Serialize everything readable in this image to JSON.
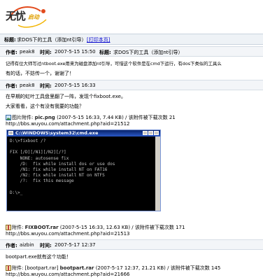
{
  "logo": {
    "wu": "无忧",
    "sub": "启动"
  },
  "topic": {
    "label": "标题:",
    "title": "求DOS下的工具（添加nt引导）",
    "print_link": "[打印本页]"
  },
  "posts": [
    {
      "author_label": "作者:",
      "author": "peak8",
      "time_label": "时间:",
      "time": "2007-5-15 15:50",
      "subject_label": "标题:",
      "subject": "求DOS下的工具（添加nt引导）",
      "body": [
        "记得有位大师写过ntboot.exe用来为磁盘添加nt引导，可惜这个软件是在cmd下运行，有dos下类似的工具么",
        "有的话，不妨传一个，谢谢了！"
      ]
    },
    {
      "author_label": "作者:",
      "author": "peak8",
      "time_label": "时间:",
      "time": "2007-5-15 16:33",
      "body": [
        "在早期的虹叶工具盘里翻了一阵，发现个fixboot.exe。",
        "大家看看，这个有没有我要的功能？"
      ],
      "image_attachment": {
        "prefix": "图片附件:",
        "name": "pic.png",
        "meta": "(2007-5-15 16:33, 7.44 KB) / 该附件被下载次数 21",
        "url": "http://bbs.wuyou.com/attachment.php?aid=21512"
      },
      "console": {
        "title": "C:\\WINDOWS\\system32\\cmd.exe",
        "lines": [
          "D:\\>fixboot /?",
          "",
          "FIX [/D][/N1][/N2][/?]",
          "    NONE: autosense fix",
          "    /D:  fix while install dos or use dos",
          "    /N1: fix while install NT on FAT16",
          "    /N2: fix while install NT on NTFS",
          "    /?:  fix this message",
          "",
          "D:\\>_"
        ]
      },
      "file_attachment": {
        "prefix": "附件:",
        "name": "FIXBOOT.rar",
        "meta": "(2007-5-15 16:33, 12.63 KB) / 该附件被下载次数 171",
        "url": "http://bbs.wuyou.com/attachment.php?aid=21513"
      }
    },
    {
      "author_label": "作者:",
      "author": "aizbin",
      "time_label": "时间:",
      "time": "2007-5-17 12:37",
      "body": [
        "bootpart.exe就有这个功能！"
      ],
      "file_attachment": {
        "prefix": "附件:",
        "tag": "[bootpart.rar]",
        "name": "bootpart.rar",
        "meta": "(2007-5-17 12:37, 21.21 KB) / 该附件被下载次数 145",
        "url": "http://bbs.wuyou.com/attachment.php?aid=21666"
      }
    }
  ]
}
